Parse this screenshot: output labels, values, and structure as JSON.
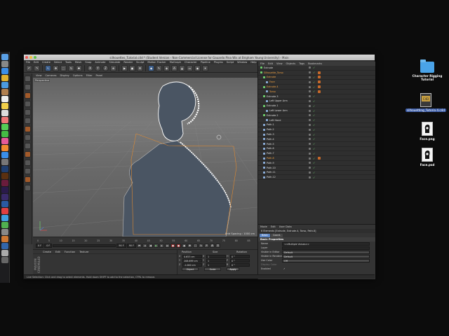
{
  "window": {
    "title": "silhouettes_Tutorial.c4d * (Student Version - Non-Commercial License for Gauardo Pina Wis at Brigham Young University) - Main"
  },
  "menubar": [
    "File",
    "Edit",
    "Create",
    "Select",
    "Tools",
    "Mesh",
    "Snap",
    "Animate",
    "Simulate",
    "Render",
    "Sculpt",
    "Motion Tracker",
    "MoGraph",
    "Character",
    "Pipeline",
    "Plugins",
    "Script",
    "Window",
    "Help"
  ],
  "viewport": {
    "menu": [
      "View",
      "Cameras",
      "Display",
      "Options",
      "Filter",
      "Panel"
    ],
    "label": "Perspective",
    "grid_spacing": "Grid Spacing : 1000 cm"
  },
  "timeline": {
    "ticks": [
      "0",
      "5",
      "10",
      "15",
      "20",
      "25",
      "30",
      "35",
      "40",
      "45",
      "50",
      "55",
      "60",
      "65",
      "70",
      "75",
      "80",
      "85",
      "90"
    ],
    "start_field": "0 F",
    "current_field": "0 F",
    "end_field": "90 F",
    "end_field2": "90 F"
  },
  "material_panel": {
    "menu": [
      "Create",
      "Edit",
      "Function",
      "Texture"
    ],
    "brand": "MAXON CINEMA4D"
  },
  "coordinates": {
    "headers": [
      "Position",
      "Size",
      "Rotation"
    ],
    "rows": [
      {
        "axis": "X",
        "pos": "0.653 cm",
        "axis2": "X",
        "size": "1",
        "axis3": "H",
        "rot": "0 °"
      },
      {
        "axis": "Y",
        "pos": "208.699 cm",
        "axis2": "Y",
        "size": "1",
        "axis3": "P",
        "rot": "0 °"
      },
      {
        "axis": "Z",
        "pos": "-1.000 cm",
        "axis2": "Z",
        "size": "1",
        "axis3": "B",
        "rot": "0 °"
      }
    ],
    "mode1": "Object",
    "mode2": "Scale",
    "apply": "Apply"
  },
  "object_manager": {
    "menu": [
      "File",
      "Edit",
      "View",
      "Objects",
      "Tags",
      "Bookmarks"
    ],
    "items": [
      {
        "name": "Extrude",
        "indent": 0,
        "orange": false
      },
      {
        "name": "Silhouette_Torso",
        "indent": 0,
        "orange": true
      },
      {
        "name": "Extrude",
        "indent": 1,
        "orange": true
      },
      {
        "name": "Face",
        "indent": 2,
        "orange": true
      },
      {
        "name": "Extrude.4",
        "indent": 1,
        "orange": true
      },
      {
        "name": "Torso",
        "indent": 2,
        "orange": true
      },
      {
        "name": "Extrude.3",
        "indent": 1,
        "orange": false
      },
      {
        "name": "Left Upper Arm",
        "indent": 2,
        "orange": false
      },
      {
        "name": "Extrude.1",
        "indent": 1,
        "orange": false
      },
      {
        "name": "Left Lower Arm",
        "indent": 2,
        "orange": false
      },
      {
        "name": "Extrude.2",
        "indent": 1,
        "orange": false
      },
      {
        "name": "Left Hand",
        "indent": 2,
        "orange": false
      },
      {
        "name": "Path.1",
        "indent": 1,
        "orange": false
      },
      {
        "name": "Path.2",
        "indent": 1,
        "orange": false
      },
      {
        "name": "Path.3",
        "indent": 1,
        "orange": false
      },
      {
        "name": "Path.4",
        "indent": 1,
        "orange": false
      },
      {
        "name": "Path.5",
        "indent": 1,
        "orange": false
      },
      {
        "name": "Path.6",
        "indent": 1,
        "orange": false
      },
      {
        "name": "Path.7",
        "indent": 1,
        "orange": false
      },
      {
        "name": "Path.8",
        "indent": 1,
        "orange": true
      },
      {
        "name": "Path.9",
        "indent": 1,
        "orange": false
      },
      {
        "name": "Path.10",
        "indent": 1,
        "orange": false
      },
      {
        "name": "Path.11",
        "indent": 1,
        "orange": false
      },
      {
        "name": "Path.12",
        "indent": 1,
        "orange": false
      }
    ]
  },
  "attribute_manager": {
    "menu": [
      "Mode",
      "Edit",
      "User Data"
    ],
    "object_name": "6 Elements [Extrude, Extrude.4, Torso, Path.8]",
    "tabs": [
      "Basic",
      "Coord."
    ],
    "section": "Basic Properties",
    "rows": [
      {
        "label": "Name",
        "value": "<<Multiple Values>>",
        "drop": false,
        "dim": false
      },
      {
        "label": "Layer",
        "value": "",
        "drop": false,
        "dim": false
      },
      {
        "label": "Visible in Editor",
        "value": "Default",
        "drop": true,
        "dim": false
      },
      {
        "label": "Visible in Renderer",
        "value": "Default",
        "drop": true,
        "dim": false
      },
      {
        "label": "Use Color",
        "value": "Off",
        "drop": true,
        "dim": false
      },
      {
        "label": "Display Color",
        "value": "",
        "drop": false,
        "dim": true
      },
      {
        "label": "Enabled",
        "value": "✓",
        "drop": false,
        "dim": false
      }
    ]
  },
  "statusbar": "Live Selection: Click and drag to select elements. Hold down SHIFT to add to the selection, CTRL to remove.",
  "desktop": {
    "items": [
      {
        "label": "Character Rigging Tutorial",
        "kind": "folder"
      },
      {
        "label": "silhouetting_Tutoria 4.c4d",
        "kind": "file"
      },
      {
        "label": "Face.png",
        "kind": "image"
      },
      {
        "label": "Face.psd",
        "kind": "image"
      }
    ]
  },
  "colors": {
    "accent": "#5d86c4",
    "selection_orange": "#f0a040",
    "check_green": "#6fd46f"
  }
}
